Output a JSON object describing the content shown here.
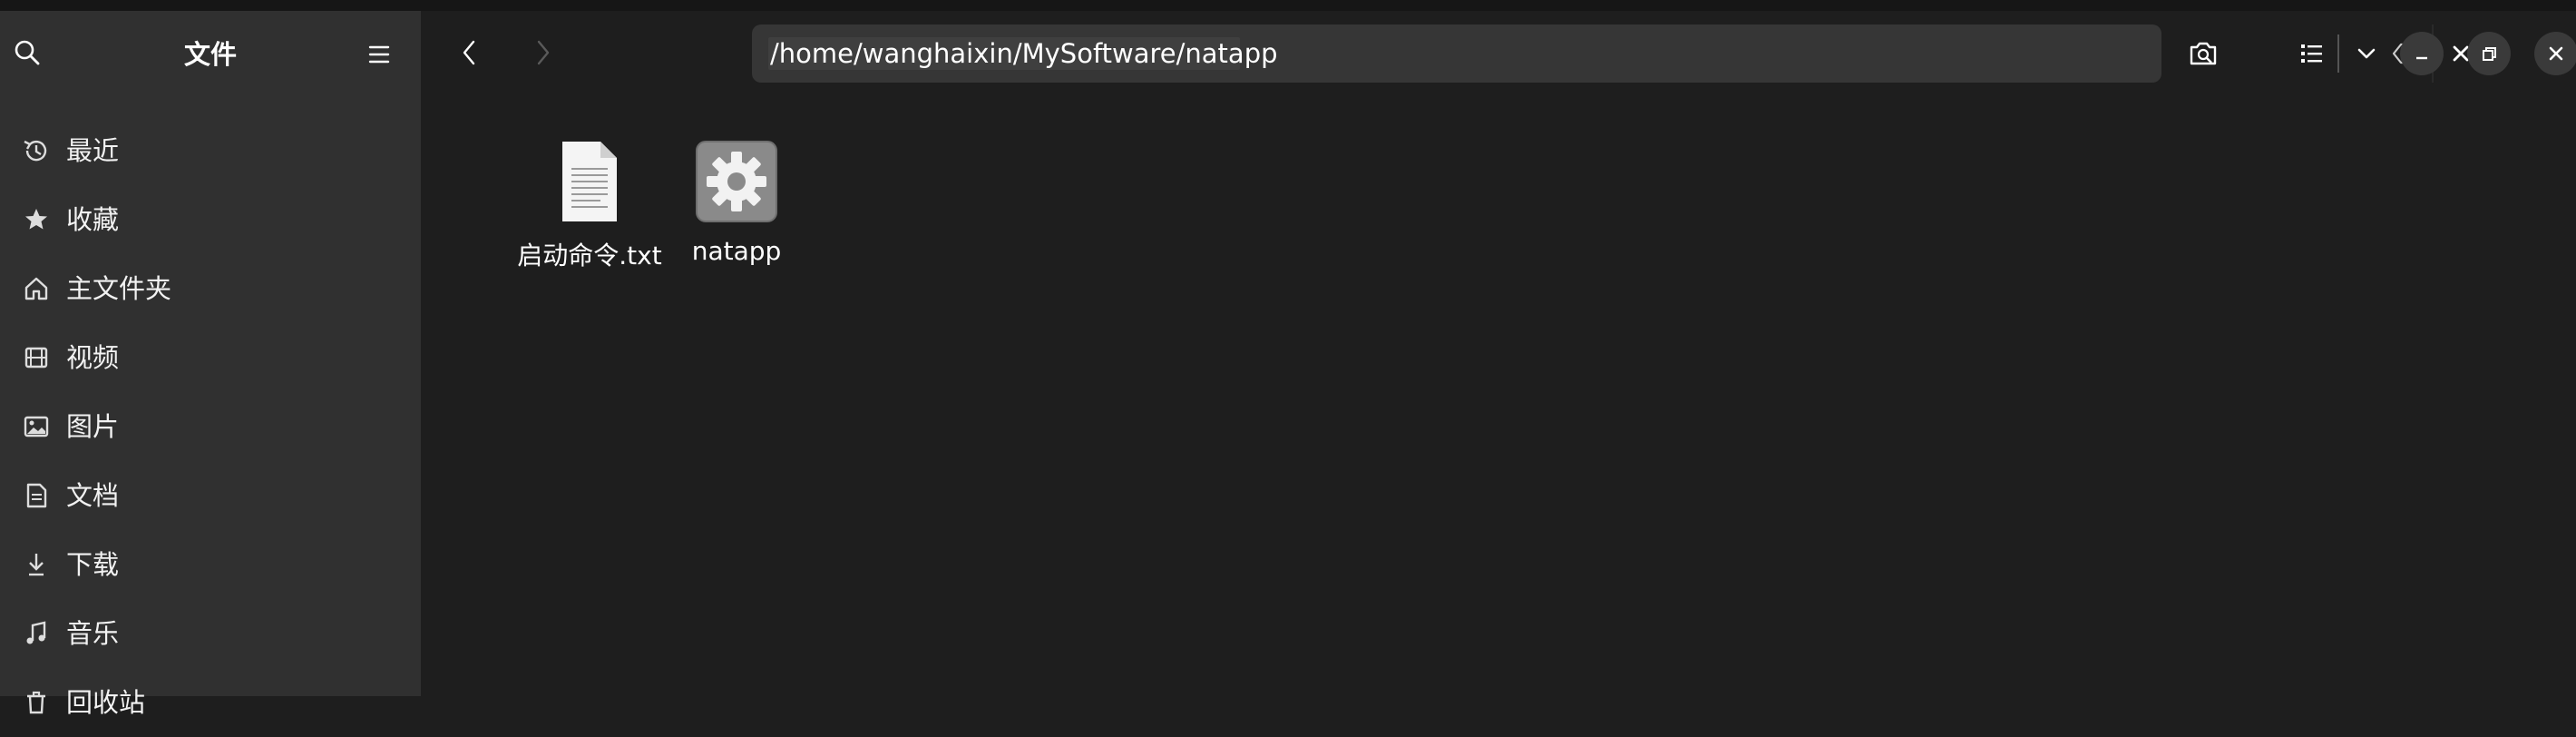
{
  "sidebar": {
    "title": "文件",
    "items": [
      {
        "label": "最近",
        "icon": "recent-icon"
      },
      {
        "label": "收藏",
        "icon": "star-icon"
      },
      {
        "label": "主文件夹",
        "icon": "home-icon"
      },
      {
        "label": "视频",
        "icon": "video-icon"
      },
      {
        "label": "图片",
        "icon": "image-icon"
      },
      {
        "label": "文档",
        "icon": "document-icon"
      },
      {
        "label": "下载",
        "icon": "download-icon"
      },
      {
        "label": "音乐",
        "icon": "music-icon"
      },
      {
        "label": "回收站",
        "icon": "trash-icon"
      }
    ]
  },
  "header": {
    "path": "/home/wanghaixin/MySoftware/natapp"
  },
  "files": [
    {
      "name": "启动命令.txt",
      "icon": "text-file-icon"
    },
    {
      "name": "natapp",
      "icon": "executable-gear-icon"
    }
  ],
  "colors": {
    "sidebar_bg": "#303030",
    "main_bg": "#1e1e1e",
    "pathbar_bg": "#363636",
    "button_bg": "#3a3a3a"
  }
}
